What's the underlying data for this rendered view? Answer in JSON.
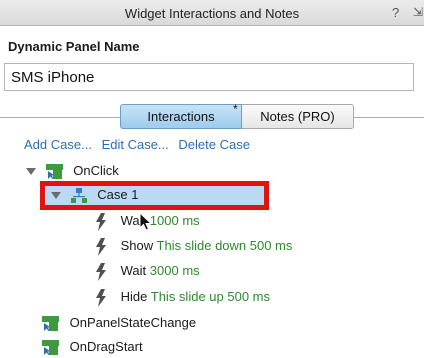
{
  "window": {
    "title": "Widget Interactions and Notes",
    "help": "?",
    "dock": "⇲"
  },
  "panel": {
    "label": "Dynamic Panel Name",
    "name_value": "SMS iPhone"
  },
  "tabs": [
    {
      "label": "Interactions",
      "marker": "*"
    },
    {
      "label": "Notes (PRO)"
    }
  ],
  "links": {
    "add": "Add Case...",
    "edit": "Edit Case...",
    "delete": "Delete Case"
  },
  "tree": {
    "events": [
      {
        "name": "OnClick"
      },
      {
        "name": "OnPanelStateChange"
      },
      {
        "name": "OnDragStart"
      }
    ],
    "case": {
      "label": "Case 1"
    },
    "actions": [
      {
        "verb": "Wait",
        "detail": "1000 ms"
      },
      {
        "verb": "Show",
        "detail": "This slide down 500 ms"
      },
      {
        "verb": "Wait",
        "detail": "3000 ms"
      },
      {
        "verb": "Hide",
        "detail": "This slide up 500 ms"
      }
    ]
  },
  "colors": {
    "highlight": "#e01212",
    "selection": "#bcd9f3",
    "action_detail": "#2e8a2e",
    "link": "#2a6fb5"
  }
}
